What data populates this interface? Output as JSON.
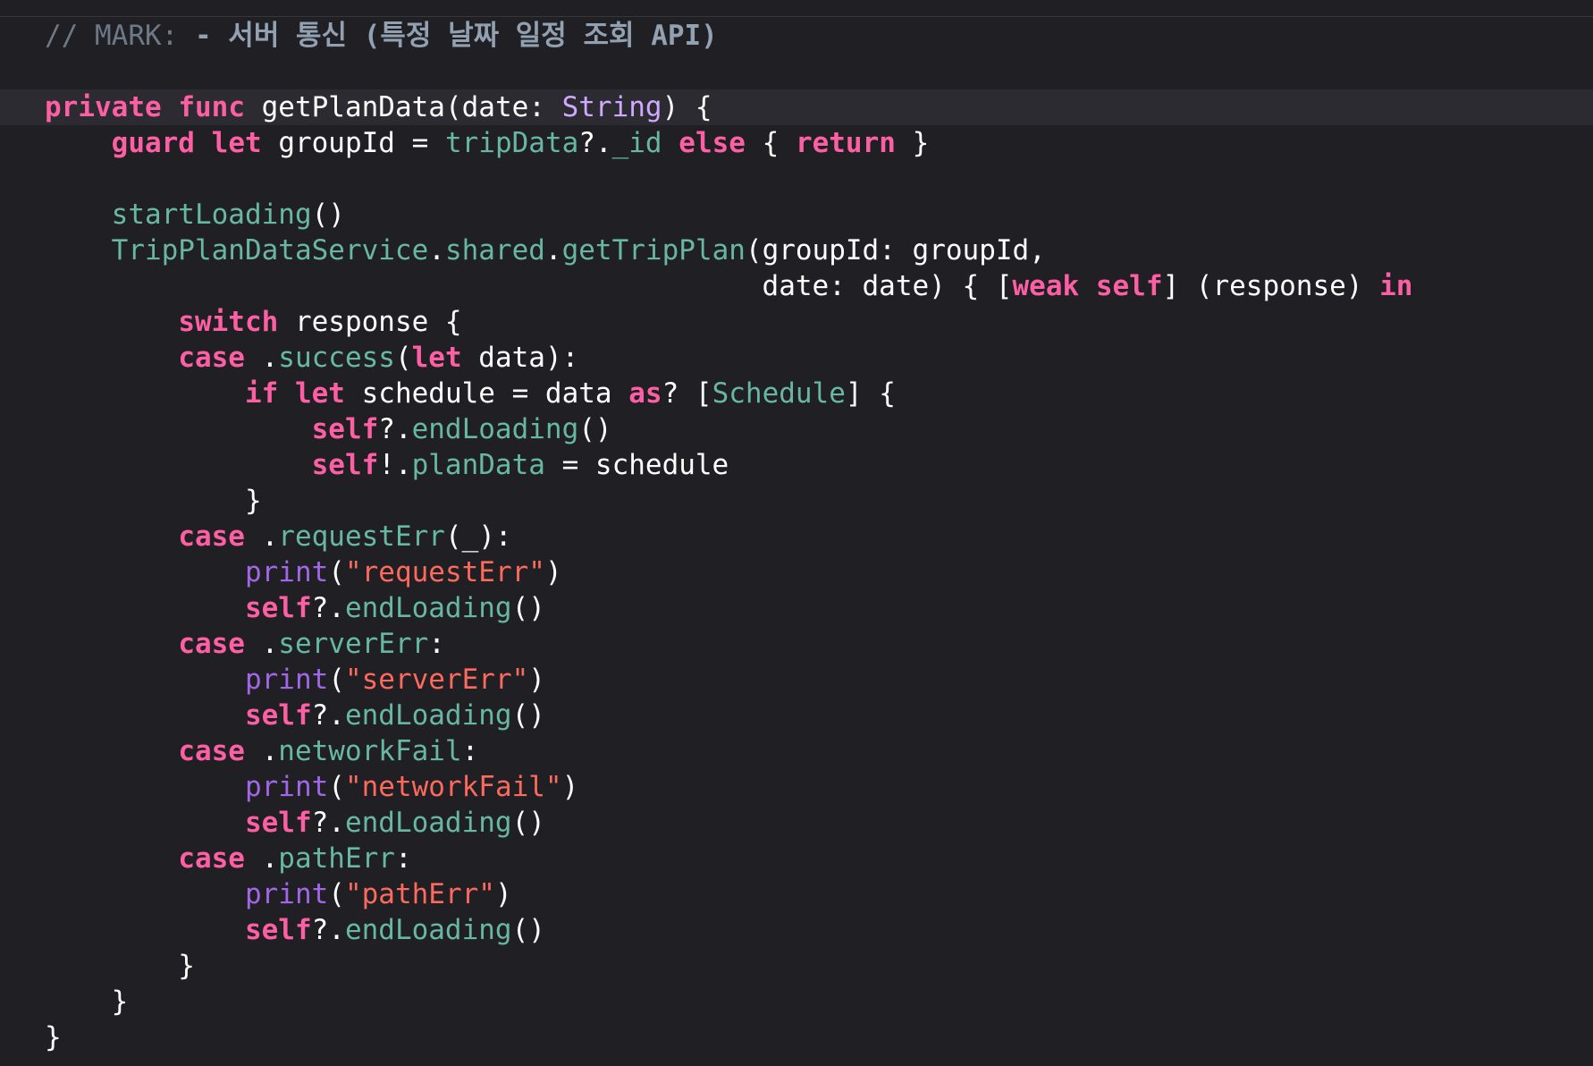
{
  "editor": {
    "colors": {
      "background": "#1f1f24",
      "current_line": "#2b2b31",
      "keyword": "#fc5fa3",
      "comment": "#6c7986",
      "mark": "#92a1b1",
      "type": "#d0a8ff",
      "project_symbol": "#67b7a4",
      "string": "#fc6a5d",
      "plain": "#ffffff",
      "library_function": "#a167e6"
    },
    "lines": [
      {
        "tokens": [
          {
            "c": "cmt",
            "t": "// MARK: "
          },
          {
            "c": "mark",
            "t": "- 서버 통신 (특정 날짜 일정 조회 API)"
          }
        ]
      },
      {
        "tokens": []
      },
      {
        "current": true,
        "tokens": [
          {
            "c": "kw",
            "t": "private"
          },
          {
            "c": "plain",
            "t": " "
          },
          {
            "c": "kw",
            "t": "func"
          },
          {
            "c": "plain",
            "t": " getPlanData(date: "
          },
          {
            "c": "type",
            "t": "String"
          },
          {
            "c": "plain",
            "t": ") {"
          }
        ]
      },
      {
        "tokens": [
          {
            "c": "plain",
            "t": "    "
          },
          {
            "c": "kw",
            "t": "guard"
          },
          {
            "c": "plain",
            "t": " "
          },
          {
            "c": "kw",
            "t": "let"
          },
          {
            "c": "plain",
            "t": " groupId = "
          },
          {
            "c": "proj",
            "t": "tripData"
          },
          {
            "c": "plain",
            "t": "?."
          },
          {
            "c": "proj",
            "t": "_id"
          },
          {
            "c": "plain",
            "t": " "
          },
          {
            "c": "kw",
            "t": "else"
          },
          {
            "c": "plain",
            "t": " { "
          },
          {
            "c": "kw",
            "t": "return"
          },
          {
            "c": "plain",
            "t": " }"
          }
        ]
      },
      {
        "tokens": []
      },
      {
        "tokens": [
          {
            "c": "plain",
            "t": "    "
          },
          {
            "c": "proj",
            "t": "startLoading"
          },
          {
            "c": "plain",
            "t": "()"
          }
        ]
      },
      {
        "tokens": [
          {
            "c": "plain",
            "t": "    "
          },
          {
            "c": "proj",
            "t": "TripPlanDataService"
          },
          {
            "c": "plain",
            "t": "."
          },
          {
            "c": "proj",
            "t": "shared"
          },
          {
            "c": "plain",
            "t": "."
          },
          {
            "c": "proj",
            "t": "getTripPlan"
          },
          {
            "c": "plain",
            "t": "(groupId: groupId,"
          }
        ]
      },
      {
        "tokens": [
          {
            "c": "plain",
            "t": "                                           date: date) { ["
          },
          {
            "c": "kw",
            "t": "weak"
          },
          {
            "c": "plain",
            "t": " "
          },
          {
            "c": "kw",
            "t": "self"
          },
          {
            "c": "plain",
            "t": "] (response) "
          },
          {
            "c": "kw",
            "t": "in"
          }
        ]
      },
      {
        "tokens": [
          {
            "c": "plain",
            "t": "        "
          },
          {
            "c": "kw",
            "t": "switch"
          },
          {
            "c": "plain",
            "t": " response {"
          }
        ]
      },
      {
        "tokens": [
          {
            "c": "plain",
            "t": "        "
          },
          {
            "c": "kw",
            "t": "case"
          },
          {
            "c": "plain",
            "t": " ."
          },
          {
            "c": "proj",
            "t": "success"
          },
          {
            "c": "plain",
            "t": "("
          },
          {
            "c": "kw",
            "t": "let"
          },
          {
            "c": "plain",
            "t": " data):"
          }
        ]
      },
      {
        "tokens": [
          {
            "c": "plain",
            "t": "            "
          },
          {
            "c": "kw",
            "t": "if"
          },
          {
            "c": "plain",
            "t": " "
          },
          {
            "c": "kw",
            "t": "let"
          },
          {
            "c": "plain",
            "t": " schedule = data "
          },
          {
            "c": "kw",
            "t": "as"
          },
          {
            "c": "plain",
            "t": "? ["
          },
          {
            "c": "proj",
            "t": "Schedule"
          },
          {
            "c": "plain",
            "t": "] {"
          }
        ]
      },
      {
        "tokens": [
          {
            "c": "plain",
            "t": "                "
          },
          {
            "c": "kw",
            "t": "self"
          },
          {
            "c": "plain",
            "t": "?."
          },
          {
            "c": "proj",
            "t": "endLoading"
          },
          {
            "c": "plain",
            "t": "()"
          }
        ]
      },
      {
        "tokens": [
          {
            "c": "plain",
            "t": "                "
          },
          {
            "c": "kw",
            "t": "self"
          },
          {
            "c": "plain",
            "t": "!."
          },
          {
            "c": "proj",
            "t": "planData"
          },
          {
            "c": "plain",
            "t": " = schedule"
          }
        ]
      },
      {
        "tokens": [
          {
            "c": "plain",
            "t": "            }"
          }
        ]
      },
      {
        "tokens": [
          {
            "c": "plain",
            "t": "        "
          },
          {
            "c": "kw",
            "t": "case"
          },
          {
            "c": "plain",
            "t": " ."
          },
          {
            "c": "proj",
            "t": "requestErr"
          },
          {
            "c": "plain",
            "t": "(_):"
          }
        ]
      },
      {
        "tokens": [
          {
            "c": "plain",
            "t": "            "
          },
          {
            "c": "lib",
            "t": "print"
          },
          {
            "c": "plain",
            "t": "("
          },
          {
            "c": "str",
            "t": "\"requestErr\""
          },
          {
            "c": "plain",
            "t": ")"
          }
        ]
      },
      {
        "tokens": [
          {
            "c": "plain",
            "t": "            "
          },
          {
            "c": "kw",
            "t": "self"
          },
          {
            "c": "plain",
            "t": "?."
          },
          {
            "c": "proj",
            "t": "endLoading"
          },
          {
            "c": "plain",
            "t": "()"
          }
        ]
      },
      {
        "tokens": [
          {
            "c": "plain",
            "t": "        "
          },
          {
            "c": "kw",
            "t": "case"
          },
          {
            "c": "plain",
            "t": " ."
          },
          {
            "c": "proj",
            "t": "serverErr"
          },
          {
            "c": "plain",
            "t": ":"
          }
        ]
      },
      {
        "tokens": [
          {
            "c": "plain",
            "t": "            "
          },
          {
            "c": "lib",
            "t": "print"
          },
          {
            "c": "plain",
            "t": "("
          },
          {
            "c": "str",
            "t": "\"serverErr\""
          },
          {
            "c": "plain",
            "t": ")"
          }
        ]
      },
      {
        "tokens": [
          {
            "c": "plain",
            "t": "            "
          },
          {
            "c": "kw",
            "t": "self"
          },
          {
            "c": "plain",
            "t": "?."
          },
          {
            "c": "proj",
            "t": "endLoading"
          },
          {
            "c": "plain",
            "t": "()"
          }
        ]
      },
      {
        "tokens": [
          {
            "c": "plain",
            "t": "        "
          },
          {
            "c": "kw",
            "t": "case"
          },
          {
            "c": "plain",
            "t": " ."
          },
          {
            "c": "proj",
            "t": "networkFail"
          },
          {
            "c": "plain",
            "t": ":"
          }
        ]
      },
      {
        "tokens": [
          {
            "c": "plain",
            "t": "            "
          },
          {
            "c": "lib",
            "t": "print"
          },
          {
            "c": "plain",
            "t": "("
          },
          {
            "c": "str",
            "t": "\"networkFail\""
          },
          {
            "c": "plain",
            "t": ")"
          }
        ]
      },
      {
        "tokens": [
          {
            "c": "plain",
            "t": "            "
          },
          {
            "c": "kw",
            "t": "self"
          },
          {
            "c": "plain",
            "t": "?."
          },
          {
            "c": "proj",
            "t": "endLoading"
          },
          {
            "c": "plain",
            "t": "()"
          }
        ]
      },
      {
        "tokens": [
          {
            "c": "plain",
            "t": "        "
          },
          {
            "c": "kw",
            "t": "case"
          },
          {
            "c": "plain",
            "t": " ."
          },
          {
            "c": "proj",
            "t": "pathErr"
          },
          {
            "c": "plain",
            "t": ":"
          }
        ]
      },
      {
        "tokens": [
          {
            "c": "plain",
            "t": "            "
          },
          {
            "c": "lib",
            "t": "print"
          },
          {
            "c": "plain",
            "t": "("
          },
          {
            "c": "str",
            "t": "\"pathErr\""
          },
          {
            "c": "plain",
            "t": ")"
          }
        ]
      },
      {
        "tokens": [
          {
            "c": "plain",
            "t": "            "
          },
          {
            "c": "kw",
            "t": "self"
          },
          {
            "c": "plain",
            "t": "?."
          },
          {
            "c": "proj",
            "t": "endLoading"
          },
          {
            "c": "plain",
            "t": "()"
          }
        ]
      },
      {
        "tokens": [
          {
            "c": "plain",
            "t": "        }"
          }
        ]
      },
      {
        "tokens": [
          {
            "c": "plain",
            "t": "    }"
          }
        ]
      },
      {
        "tokens": [
          {
            "c": "plain",
            "t": "}"
          }
        ]
      }
    ]
  }
}
